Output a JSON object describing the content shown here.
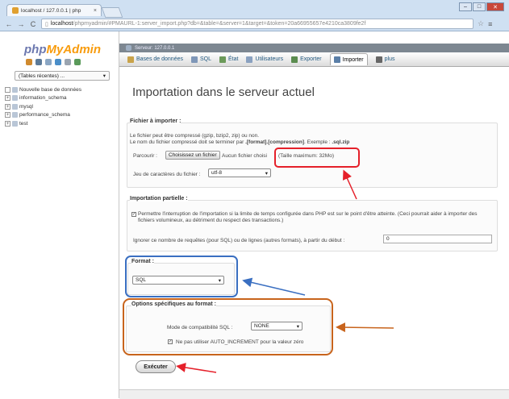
{
  "browser": {
    "tab_title": "localhost / 127.0.0.1 | php",
    "tab_close": "×",
    "url_host": "localhost",
    "url_path": "/phpmyadmin/#PMAURL-1:server_import.php?db=&table=&server=1&target=&token=20a66955657e4210ca3809fe2f",
    "window_buttons": [
      "–",
      "□",
      "✕"
    ]
  },
  "sidebar": {
    "logo_php": "php",
    "logo_admin": "MyAdmin",
    "recent_label": "(Tables récentes) ...",
    "databases": [
      {
        "toggle": "",
        "name": "Nouvelle base de données"
      },
      {
        "toggle": "+",
        "name": "information_schema"
      },
      {
        "toggle": "+",
        "name": "mysql"
      },
      {
        "toggle": "+",
        "name": "performance_schema"
      },
      {
        "toggle": "+",
        "name": "test"
      }
    ]
  },
  "topstrip": {
    "server": "Serveur: 127.0.0.1"
  },
  "tabs": [
    {
      "label": "Bases de données",
      "icon_color": "#c9a34a",
      "active": false
    },
    {
      "label": "SQL",
      "icon_color": "#7f97b8",
      "active": false
    },
    {
      "label": "État",
      "icon_color": "#6c9a5a",
      "active": false
    },
    {
      "label": "Utilisateurs",
      "icon_color": "#8aa1c0",
      "active": false
    },
    {
      "label": "Exporter",
      "icon_color": "#5b8c4f",
      "active": false
    },
    {
      "label": "Importer",
      "icon_color": "#5b7fa8",
      "active": true
    },
    {
      "label": "plus",
      "icon_color": "#666666",
      "active": false
    }
  ],
  "main": {
    "heading": "Importation dans le serveur actuel",
    "file_section": {
      "legend": "Fichier à importer :",
      "line1": "Le fichier peut être compressé (gzip, bzip2, zip) ou non.",
      "line2_a": "Le nom du fichier compressé doit se terminer par ",
      "line2_b": ".[format].[compression]",
      "line2_c": ". Exemple : ",
      "line2_d": ".sql.zip",
      "browse_label": "Parcourir :",
      "choose_button": "Choisissez un fichier",
      "no_file": "Aucun fichier choisi",
      "max_size": "(Taille maximum: 32Mo)",
      "charset_label": "Jeu de caractères du fichier :",
      "charset_value": "utf-8"
    },
    "partial_section": {
      "legend": "Importation partielle :",
      "allow_interrupt": "Permettre l'interruption de l'importation si la limite de temps configurée dans PHP est sur le point d'être atteinte. (Ceci pourrait aider à importer des fichiers volumineux, au détriment du respect des transactions.)",
      "skip_label": "Ignorer ce nombre de requêtes (pour SQL) ou de lignes (autres formats), à partir du début :",
      "skip_value": "0"
    },
    "format_section": {
      "legend": "Format :",
      "value": "SQL"
    },
    "options_section": {
      "legend": "Options spécifiques au format :",
      "compat_label": "Mode de compatibilité SQL :",
      "compat_value": "NONE",
      "auto_increment": "Ne pas utiliser AUTO_INCREMENT pour la valeur zéro"
    },
    "execute_button": "Exécuter"
  },
  "annotation_colors": {
    "red": "#e5202a",
    "blue": "#3a6fc1",
    "orange": "#c8641c"
  }
}
